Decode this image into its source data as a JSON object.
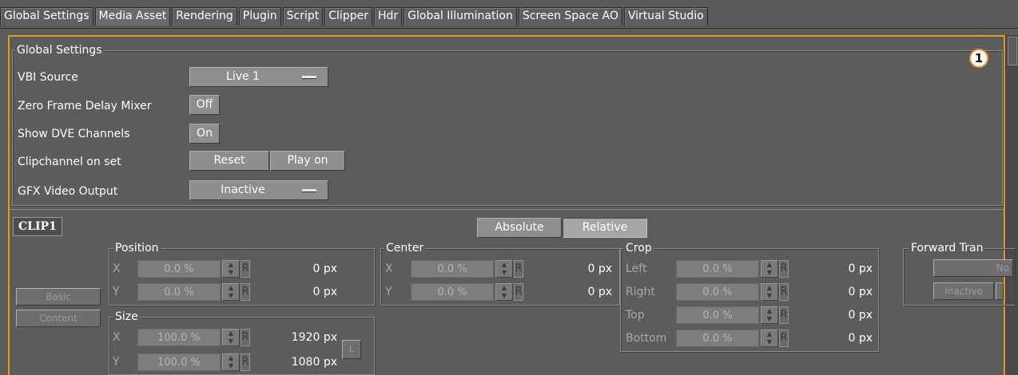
{
  "tabs": [
    {
      "label": "Global Settings"
    },
    {
      "label": "Media Asset",
      "active": true
    },
    {
      "label": "Rendering"
    },
    {
      "label": "Plugin"
    },
    {
      "label": "Script"
    },
    {
      "label": "Clipper"
    },
    {
      "label": "Hdr"
    },
    {
      "label": "Global Illumination"
    },
    {
      "label": "Screen Space AO"
    },
    {
      "label": "Virtual Studio"
    }
  ],
  "callout_number": "1",
  "global_settings": {
    "title": "Global Settings",
    "vbi_source": {
      "label": "VBI Source",
      "value": "Live 1"
    },
    "zero_frame_delay": {
      "label": "Zero Frame Delay Mixer",
      "value": "Off"
    },
    "show_dve": {
      "label": "Show DVE Channels",
      "value": "On"
    },
    "clipchannel": {
      "label": "Clipchannel on set",
      "reset": "Reset",
      "play_on": "Play on"
    },
    "gfx_output": {
      "label": "GFX Video Output",
      "value": "Inactive"
    }
  },
  "clip": {
    "tag": "CLIP1",
    "mode_absolute": "Absolute",
    "mode_relative": "Relative",
    "basic_label": "Basic",
    "content_label": "Content",
    "position": {
      "title": "Position",
      "x": {
        "axis": "X",
        "value": "0.0 %",
        "px": "0 px"
      },
      "y": {
        "axis": "Y",
        "value": "0.0 %",
        "px": "0 px"
      }
    },
    "size": {
      "title": "Size",
      "x": {
        "axis": "X",
        "value": "100.0 %",
        "px": "1920 px"
      },
      "y": {
        "axis": "Y",
        "value": "100.0 %",
        "px": "1080 px"
      },
      "lock_label": "L"
    },
    "center": {
      "title": "Center",
      "x": {
        "axis": "X",
        "value": "0.0 %",
        "px": "0 px"
      },
      "y": {
        "axis": "Y",
        "value": "0.0 %",
        "px": "0 px"
      }
    },
    "crop": {
      "title": "Crop",
      "left": {
        "axis": "Left",
        "value": "0.0 %",
        "px": "0 px"
      },
      "right": {
        "axis": "Right",
        "value": "0.0 %",
        "px": "0 px"
      },
      "top": {
        "axis": "Top",
        "value": "0.0 %",
        "px": "0 px"
      },
      "bottom": {
        "axis": "Bottom",
        "value": "0.0 %",
        "px": "0 px"
      }
    },
    "forward": {
      "title": "Forward Tran",
      "btn1": "No",
      "btn2": "Inactive"
    },
    "reset_symbol": "R",
    "spin_up": "▲",
    "spin_down": "▼"
  }
}
